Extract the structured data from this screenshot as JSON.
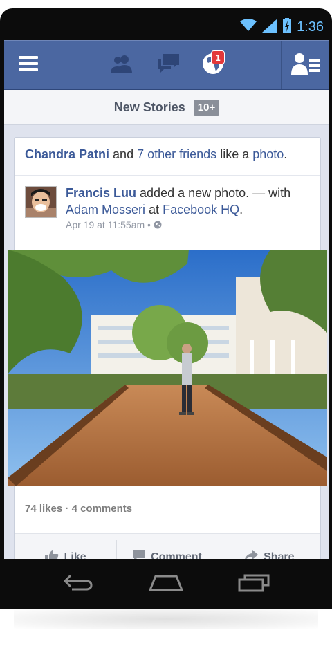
{
  "status_bar": {
    "time": "1:36"
  },
  "navbar": {
    "notification_count": "1",
    "icons": [
      "menu-icon",
      "friend-requests-icon",
      "messages-icon",
      "notifications-globe-icon",
      "friends-list-icon"
    ]
  },
  "new_stories": {
    "label": "New Stories",
    "count": "10+"
  },
  "story": {
    "liker_name": "Chandra Patni",
    "liker_and": "and",
    "liker_others": "7 other friends",
    "liker_suffix": "like a",
    "liker_object": "photo",
    "liker_period": ".",
    "author": "Francis Luu",
    "action": "added a new photo. — with",
    "tagged": "Adam Mosseri",
    "at": "at",
    "place": "Facebook HQ",
    "place_period": ".",
    "timestamp": "Apr 19 at 11:55am",
    "separator": "•",
    "likes": "74 likes",
    "stats_sep": "·",
    "comments": "4 comments"
  },
  "actions": {
    "like": "Like",
    "comment": "Comment",
    "share": "Share"
  },
  "colors": {
    "brand": "#4b67a1",
    "link": "#3b5998",
    "status_accent": "#6cc1ff",
    "badge": "#e3383a"
  }
}
